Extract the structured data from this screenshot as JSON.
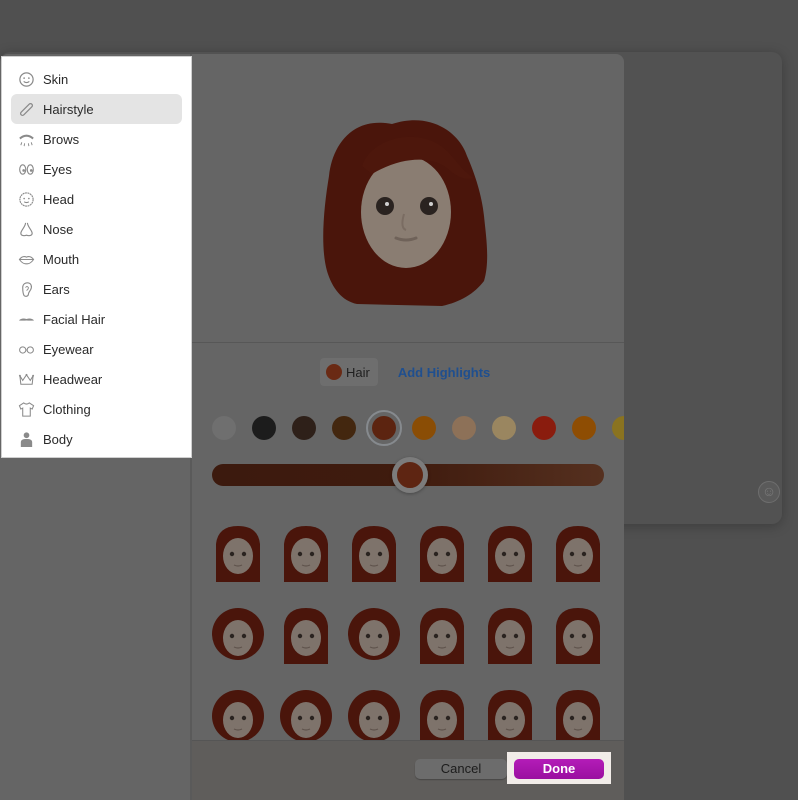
{
  "background_window": {
    "emoji_button_icon": "smiley-face-icon"
  },
  "sidebar": {
    "selected": "Hairstyle",
    "items": [
      {
        "label": "Skin",
        "icon": "smiley-face-icon"
      },
      {
        "label": "Hairstyle",
        "icon": "comb-icon"
      },
      {
        "label": "Brows",
        "icon": "brow-icon"
      },
      {
        "label": "Eyes",
        "icon": "eyes-icon"
      },
      {
        "label": "Head",
        "icon": "face-outline-icon"
      },
      {
        "label": "Nose",
        "icon": "nose-icon"
      },
      {
        "label": "Mouth",
        "icon": "lips-icon"
      },
      {
        "label": "Ears",
        "icon": "ear-icon"
      },
      {
        "label": "Facial Hair",
        "icon": "mustache-icon"
      },
      {
        "label": "Eyewear",
        "icon": "glasses-icon"
      },
      {
        "label": "Headwear",
        "icon": "crown-icon"
      },
      {
        "label": "Clothing",
        "icon": "tshirt-icon"
      },
      {
        "label": "Body",
        "icon": "person-icon"
      }
    ]
  },
  "color_tabs": {
    "hair_label": "Hair",
    "hair_color": "#6a2a14",
    "add_highlights_label": "Add Highlights"
  },
  "swatches": {
    "selected_index": 4,
    "colors": [
      "#6f6f6f",
      "#1c1c1c",
      "#2e2019",
      "#43270f",
      "#5c2410",
      "#8a4d05",
      "#8d7158",
      "#9a8660",
      "#8a1c0e",
      "#8e4d03",
      "#8a7320"
    ]
  },
  "shade_slider": {
    "value_fraction": 0.5
  },
  "hairstyles": {
    "count_visible": 18,
    "columns": 6
  },
  "footer": {
    "cancel_label": "Cancel",
    "done_label": "Done"
  }
}
